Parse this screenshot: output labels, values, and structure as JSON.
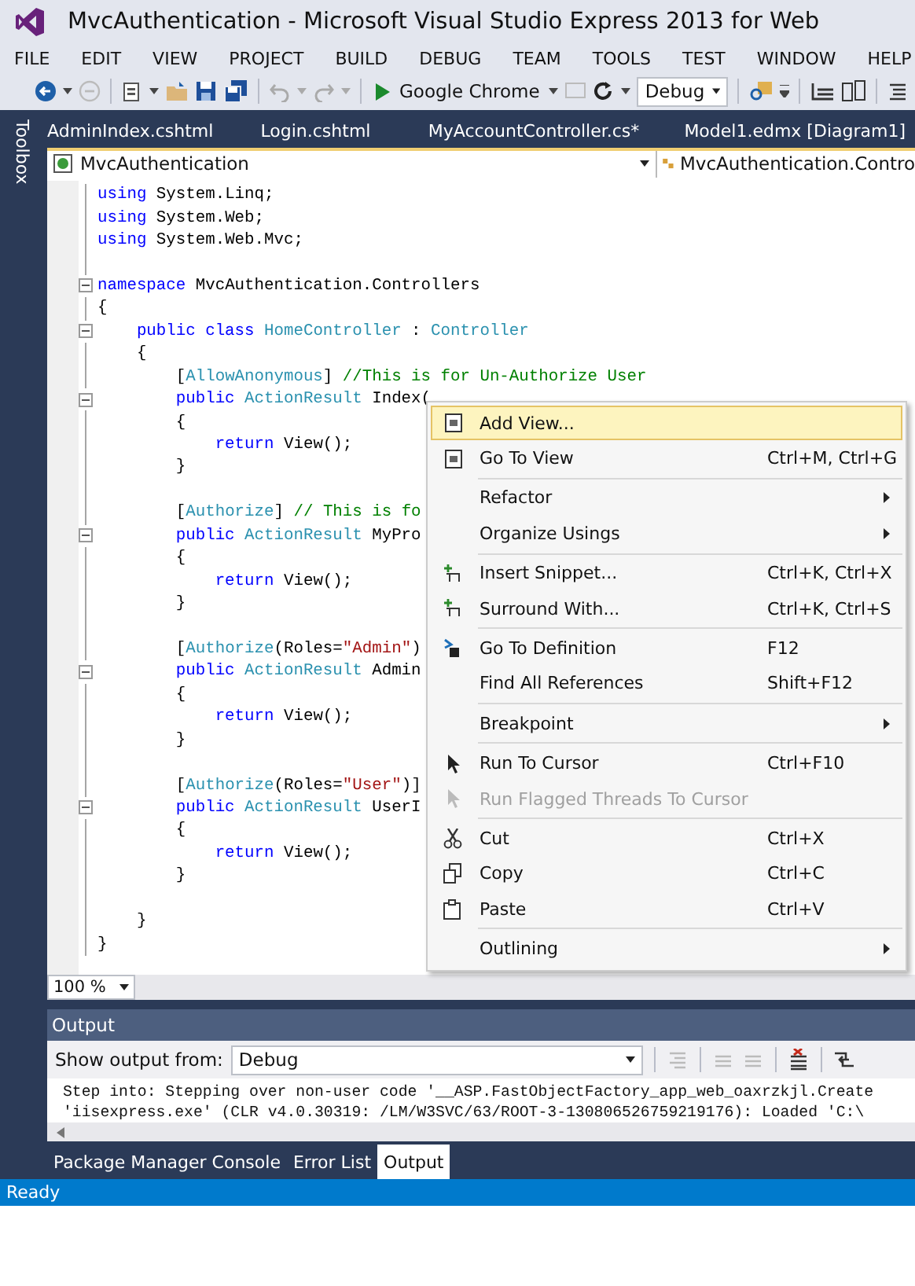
{
  "window": {
    "title": "MvcAuthentication - Microsoft Visual Studio Express 2013 for Web"
  },
  "menu_bar": [
    "FILE",
    "EDIT",
    "VIEW",
    "PROJECT",
    "BUILD",
    "DEBUG",
    "TEAM",
    "TOOLS",
    "TEST",
    "WINDOW",
    "HELP"
  ],
  "toolbar": {
    "run_target": "Google Chrome",
    "configuration": "Debug"
  },
  "toolbox_label": "Toolbox",
  "document_tabs": [
    "AdminIndex.cshtml",
    "Login.cshtml",
    "MyAccountController.cs*",
    "Model1.edmx [Diagram1]"
  ],
  "navigation_bar": {
    "project": "MvcAuthentication",
    "type": "MvcAuthentication.Contro"
  },
  "code_lines": [
    {
      "fold": false,
      "tokens": [
        {
          "kind": "kw",
          "text": "using"
        },
        {
          "kind": "plain",
          "text": " System.Linq;"
        }
      ]
    },
    {
      "fold": false,
      "tokens": [
        {
          "kind": "kw",
          "text": "using"
        },
        {
          "kind": "plain",
          "text": " System.Web;"
        }
      ]
    },
    {
      "fold": false,
      "tokens": [
        {
          "kind": "kw",
          "text": "using"
        },
        {
          "kind": "plain",
          "text": " System.Web.Mvc;"
        }
      ]
    },
    {
      "fold": false
    },
    {
      "fold": true,
      "tokens": [
        {
          "kind": "kw",
          "text": "namespace"
        },
        {
          "kind": "plain",
          "text": " MvcAuthentication.Controllers"
        }
      ]
    },
    {
      "fold": false,
      "tokens": [
        {
          "kind": "plain",
          "text": "{"
        }
      ]
    },
    {
      "fold": true,
      "tokens": [
        {
          "kind": "kw",
          "text": "    public class"
        },
        {
          "kind": "type",
          "text": " HomeController"
        },
        {
          "kind": "plain",
          "text": " :"
        },
        {
          "kind": "type",
          "text": " Controller"
        }
      ]
    },
    {
      "fold": false,
      "tokens": [
        {
          "kind": "plain",
          "text": "    {"
        }
      ]
    },
    {
      "fold": false,
      "tokens": [
        {
          "kind": "plain",
          "text": "        ["
        },
        {
          "kind": "type",
          "text": "AllowAnonymous"
        },
        {
          "kind": "plain",
          "text": "]"
        },
        {
          "kind": "comment",
          "text": " //This is for Un-Authorize User"
        }
      ]
    },
    {
      "fold": true,
      "tokens": [
        {
          "kind": "kw",
          "text": "        public"
        },
        {
          "kind": "type",
          "text": " ActionResult"
        },
        {
          "kind": "plain",
          "text": " Index("
        }
      ]
    },
    {
      "fold": false,
      "tokens": [
        {
          "kind": "plain",
          "text": "        {"
        }
      ]
    },
    {
      "fold": false,
      "tokens": [
        {
          "kind": "kw",
          "text": "            return"
        },
        {
          "kind": "plain",
          "text": " View();"
        }
      ]
    },
    {
      "fold": false,
      "tokens": [
        {
          "kind": "plain",
          "text": "        }"
        }
      ]
    },
    {
      "fold": false
    },
    {
      "fold": false,
      "tokens": [
        {
          "kind": "plain",
          "text": "        ["
        },
        {
          "kind": "type",
          "text": "Authorize"
        },
        {
          "kind": "plain",
          "text": "]"
        },
        {
          "kind": "comment",
          "text": " // This is fo"
        }
      ]
    },
    {
      "fold": true,
      "tokens": [
        {
          "kind": "kw",
          "text": "        public"
        },
        {
          "kind": "type",
          "text": " ActionResult"
        },
        {
          "kind": "plain",
          "text": " MyPro"
        }
      ]
    },
    {
      "fold": false,
      "tokens": [
        {
          "kind": "plain",
          "text": "        {"
        }
      ]
    },
    {
      "fold": false,
      "tokens": [
        {
          "kind": "kw",
          "text": "            return"
        },
        {
          "kind": "plain",
          "text": " View();"
        }
      ]
    },
    {
      "fold": false,
      "tokens": [
        {
          "kind": "plain",
          "text": "        }"
        }
      ]
    },
    {
      "fold": false
    },
    {
      "fold": false,
      "tokens": [
        {
          "kind": "plain",
          "text": "        ["
        },
        {
          "kind": "type",
          "text": "Authorize"
        },
        {
          "kind": "plain",
          "text": "(Roles="
        },
        {
          "kind": "str",
          "text": "\"Admin\""
        },
        {
          "kind": "plain",
          "text": ")"
        }
      ]
    },
    {
      "fold": true,
      "tokens": [
        {
          "kind": "kw",
          "text": "        public"
        },
        {
          "kind": "type",
          "text": " ActionResult"
        },
        {
          "kind": "plain",
          "text": " Admin"
        }
      ]
    },
    {
      "fold": false,
      "tokens": [
        {
          "kind": "plain",
          "text": "        {"
        }
      ]
    },
    {
      "fold": false,
      "tokens": [
        {
          "kind": "kw",
          "text": "            return"
        },
        {
          "kind": "plain",
          "text": " View();"
        }
      ]
    },
    {
      "fold": false,
      "tokens": [
        {
          "kind": "plain",
          "text": "        }"
        }
      ]
    },
    {
      "fold": false
    },
    {
      "fold": false,
      "tokens": [
        {
          "kind": "plain",
          "text": "        ["
        },
        {
          "kind": "type",
          "text": "Authorize"
        },
        {
          "kind": "plain",
          "text": "(Roles="
        },
        {
          "kind": "str",
          "text": "\"User\""
        },
        {
          "kind": "plain",
          "text": ")]"
        }
      ]
    },
    {
      "fold": true,
      "tokens": [
        {
          "kind": "kw",
          "text": "        public"
        },
        {
          "kind": "type",
          "text": " ActionResult"
        },
        {
          "kind": "plain",
          "text": " UserI"
        }
      ]
    },
    {
      "fold": false,
      "tokens": [
        {
          "kind": "plain",
          "text": "        {"
        }
      ]
    },
    {
      "fold": false,
      "tokens": [
        {
          "kind": "kw",
          "text": "            return"
        },
        {
          "kind": "plain",
          "text": " View();"
        }
      ]
    },
    {
      "fold": false,
      "tokens": [
        {
          "kind": "plain",
          "text": "        }"
        }
      ]
    },
    {
      "fold": false
    },
    {
      "fold": false,
      "tokens": [
        {
          "kind": "plain",
          "text": "    }"
        }
      ]
    },
    {
      "fold": false,
      "tokens": [
        {
          "kind": "plain",
          "text": "}"
        }
      ]
    }
  ],
  "context_menu": {
    "groups": [
      [
        {
          "kind": "page",
          "label": "Add View...",
          "selected": true,
          "disabled": false,
          "submenu": false
        },
        {
          "kind": "page",
          "label": "Go To View",
          "shortcut": "Ctrl+M, Ctrl+G",
          "selected": false,
          "disabled": false,
          "submenu": false
        }
      ],
      [
        {
          "label": "Refactor",
          "selected": false,
          "disabled": false,
          "submenu": true
        },
        {
          "label": "Organize Usings",
          "selected": false,
          "disabled": false,
          "submenu": true
        }
      ],
      [
        {
          "kind": "snippet",
          "label": "Insert Snippet...",
          "shortcut": "Ctrl+K, Ctrl+X",
          "selected": false,
          "disabled": false,
          "submenu": false
        },
        {
          "kind": "snippet",
          "label": "Surround With...",
          "shortcut": "Ctrl+K, Ctrl+S",
          "selected": false,
          "disabled": false,
          "submenu": false
        }
      ],
      [
        {
          "kind": "definition",
          "label": "Go To Definition",
          "shortcut": "F12",
          "selected": false,
          "disabled": false,
          "submenu": false
        },
        {
          "label": "Find All References",
          "shortcut": "Shift+F12",
          "selected": false,
          "disabled": false,
          "submenu": false
        }
      ],
      [
        {
          "label": "Breakpoint",
          "selected": false,
          "disabled": false,
          "submenu": true
        }
      ],
      [
        {
          "kind": "pointer",
          "label": "Run To Cursor",
          "shortcut": "Ctrl+F10",
          "selected": false,
          "disabled": false,
          "submenu": false
        },
        {
          "kind": "pointer",
          "label": "Run Flagged Threads To Cursor",
          "selected": false,
          "disabled": true,
          "submenu": false
        }
      ],
      [
        {
          "kind": "cut",
          "label": "Cut",
          "shortcut": "Ctrl+X",
          "selected": false,
          "disabled": false,
          "submenu": false
        },
        {
          "kind": "copy",
          "label": "Copy",
          "shortcut": "Ctrl+C",
          "selected": false,
          "disabled": false,
          "submenu": false
        },
        {
          "kind": "paste",
          "label": "Paste",
          "shortcut": "Ctrl+V",
          "selected": false,
          "disabled": false,
          "submenu": false
        }
      ],
      [
        {
          "label": "Outlining",
          "selected": false,
          "disabled": false,
          "submenu": true
        }
      ]
    ]
  },
  "zoom_level": "100 %",
  "output_panel": {
    "title": "Output",
    "source_label": "Show output from:",
    "source": "Debug",
    "lines": [
      "Step into: Stepping over non-user code '__ASP.FastObjectFactory_app_web_oaxrzkjl.Create",
      "'iisexpress.exe' (CLR v4.0.30319: /LM/W3SVC/63/ROOT-3-130806526759219176): Loaded 'C:\\"
    ]
  },
  "bottom_tabs": [
    {
      "label": "Package Manager Console",
      "selected": false
    },
    {
      "label": "Error List",
      "selected": false
    },
    {
      "label": "Output",
      "selected": true
    }
  ],
  "status_bar": {
    "text": "Ready"
  }
}
